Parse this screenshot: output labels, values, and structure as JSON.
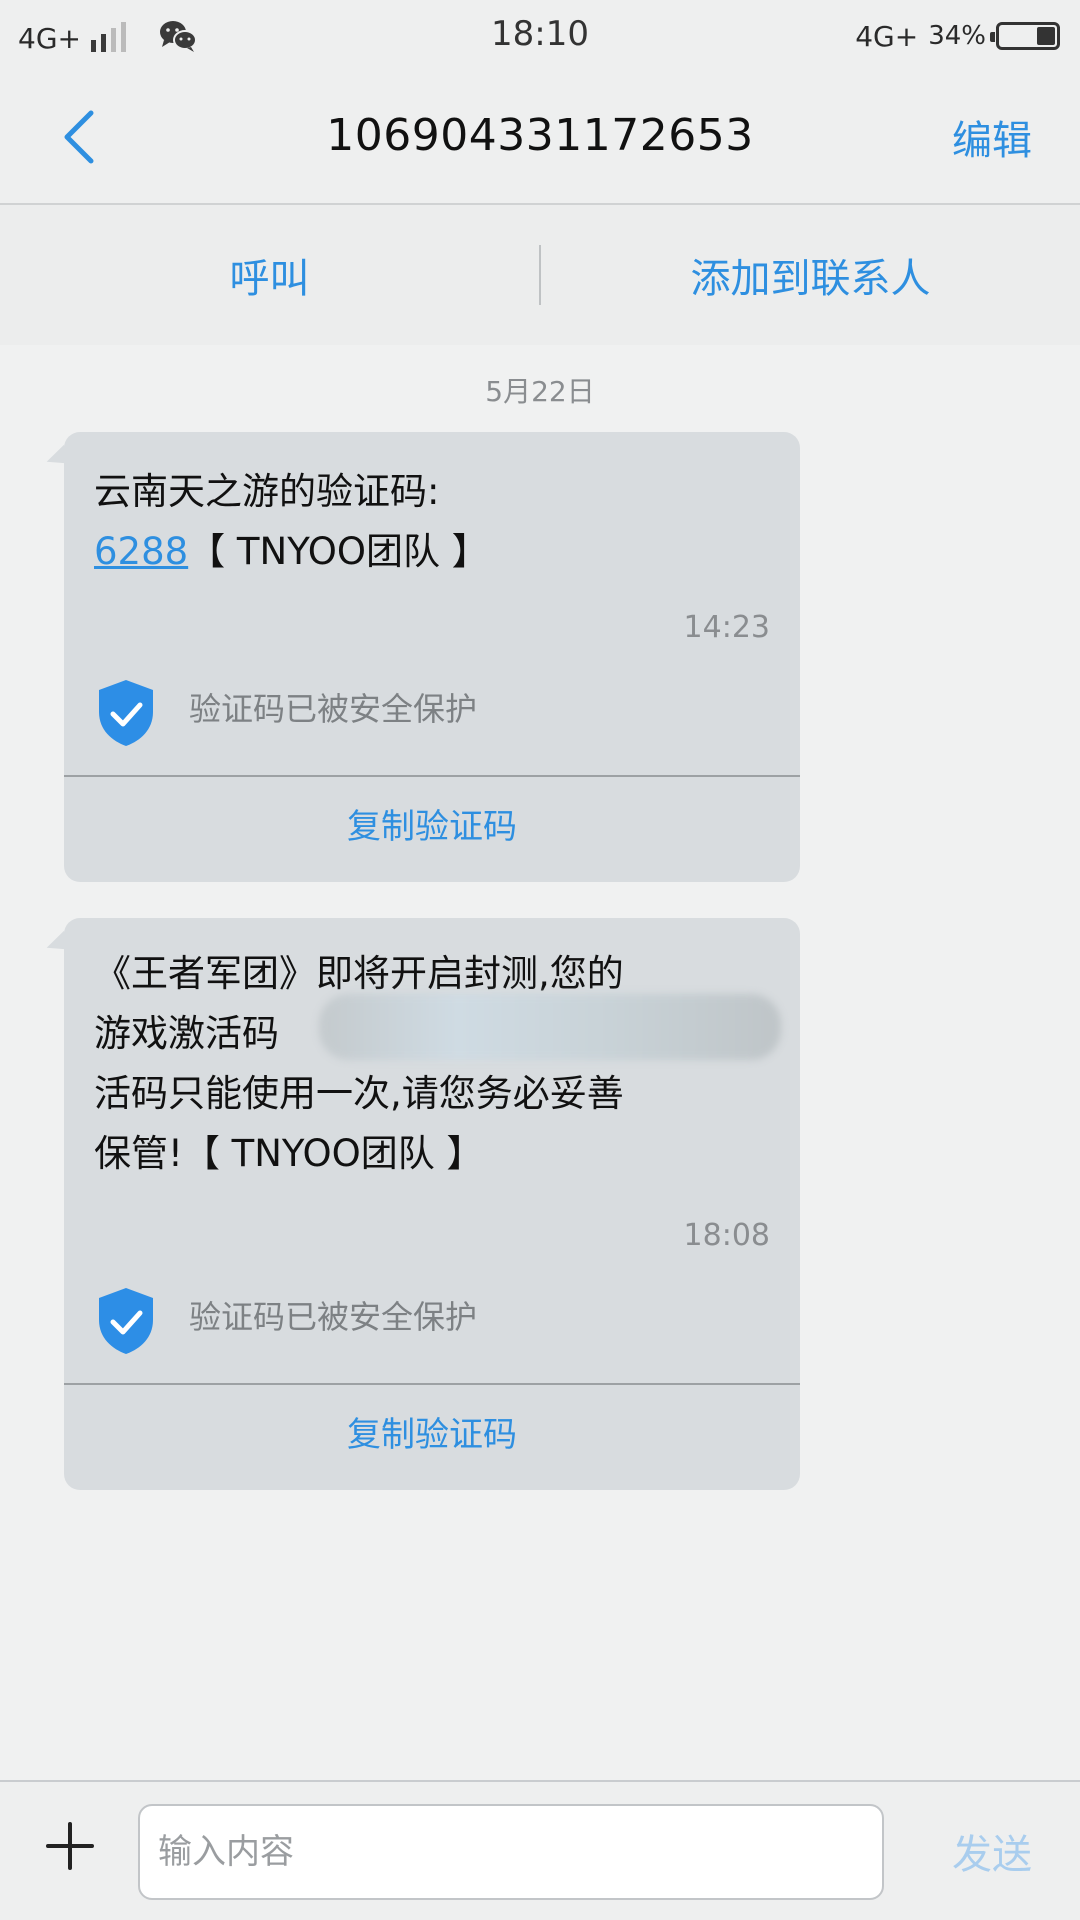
{
  "status_bar": {
    "network_left": "4G+",
    "time": "18:10",
    "network_right": "4G+",
    "battery": "34%"
  },
  "header": {
    "title": "106904331172653",
    "edit_label": "编辑"
  },
  "actions": {
    "call_label": "呼叫",
    "add_contact_label": "添加到联系人"
  },
  "date_separator": "5月22日",
  "messages": [
    {
      "text_before": "云南天之游的验证码:",
      "code": "6288",
      "text_after": "【 TNYOO团队 】",
      "time": "14:23",
      "protect_label": "验证码已被安全保护",
      "copy_label": "复制验证码"
    },
    {
      "line1": "《王者军团》即将开启封测,您的",
      "line2_start": "游戏激活码",
      "line2_end": "激",
      "line3": "活码只能使用一次,请您务必妥善",
      "line4": "保管!【 TNYOO团队 】",
      "time": "18:08",
      "protect_label": "验证码已被安全保护",
      "copy_label": "复制验证码"
    }
  ],
  "composer": {
    "placeholder": "输入内容",
    "send_label": "发送"
  },
  "colors": {
    "accent": "#2e8fe0",
    "bubble": "#d8dcdf",
    "shield": "#2d8ee6"
  }
}
